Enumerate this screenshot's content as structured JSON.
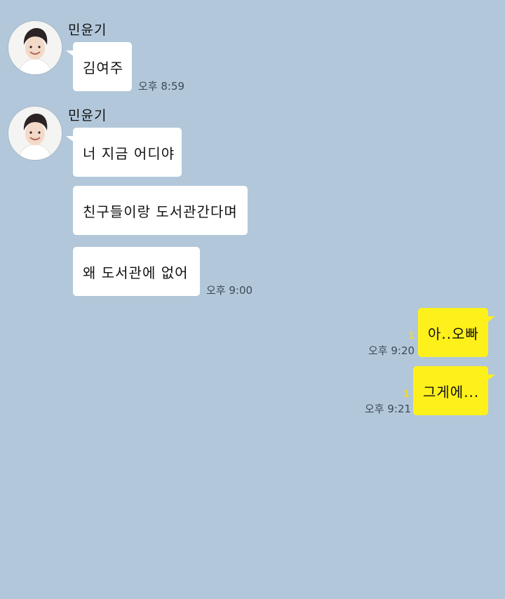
{
  "chat": {
    "groups": [
      {
        "sender": "민윤기",
        "messages": [
          {
            "text": "김여주",
            "time": "오후 8:59"
          }
        ]
      },
      {
        "sender": "민윤기",
        "messages": [
          {
            "text": "너 지금 어디야"
          },
          {
            "text": "친구들이랑 도서관간다며"
          },
          {
            "text": "왜 도서관에 없어",
            "time": "오후 9:00"
          }
        ]
      }
    ],
    "mine": [
      {
        "text": "아..오빠",
        "time": "오후 9:20",
        "unread": "1"
      },
      {
        "text": "그게에...",
        "time": "오후 9:21",
        "unread": "1"
      }
    ]
  },
  "colors": {
    "background": "#b2c7da",
    "incoming_bubble": "#ffffff",
    "outgoing_bubble": "#fef01b",
    "unread_count": "#f0d83a"
  },
  "icons": {
    "avatar": "profile-photo"
  }
}
